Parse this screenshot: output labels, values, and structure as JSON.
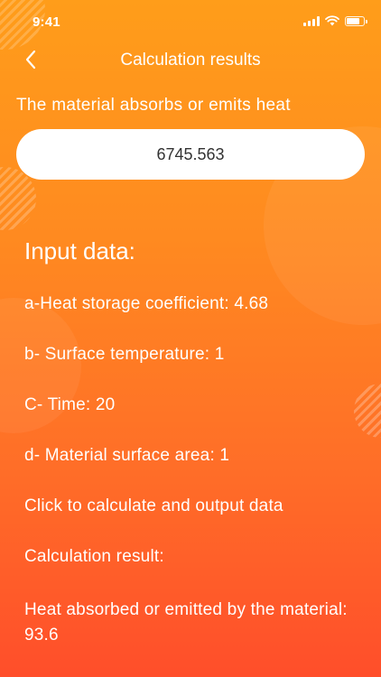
{
  "status_bar": {
    "time": "9:41",
    "battery_level": 0.85
  },
  "nav": {
    "title": "Calculation results",
    "back_icon": "chevron-left-icon"
  },
  "result": {
    "label": "The material absorbs or emits heat",
    "value": "6745.563"
  },
  "input_data": {
    "heading": "Input data:",
    "lines": [
      "a-Heat storage coefficient: 4.68",
      "b- Surface temperature: 1",
      "C- Time: 20",
      "d- Material surface area: 1",
      "Click to calculate and output data",
      "Calculation result:"
    ],
    "heat_result": "Heat absorbed or emitted by the material: 93.6"
  },
  "colors": {
    "gradient_top": "#FF9D1A",
    "gradient_bottom": "#FF4E2A",
    "field_background": "#FFFFFF",
    "field_text": "#333333"
  }
}
